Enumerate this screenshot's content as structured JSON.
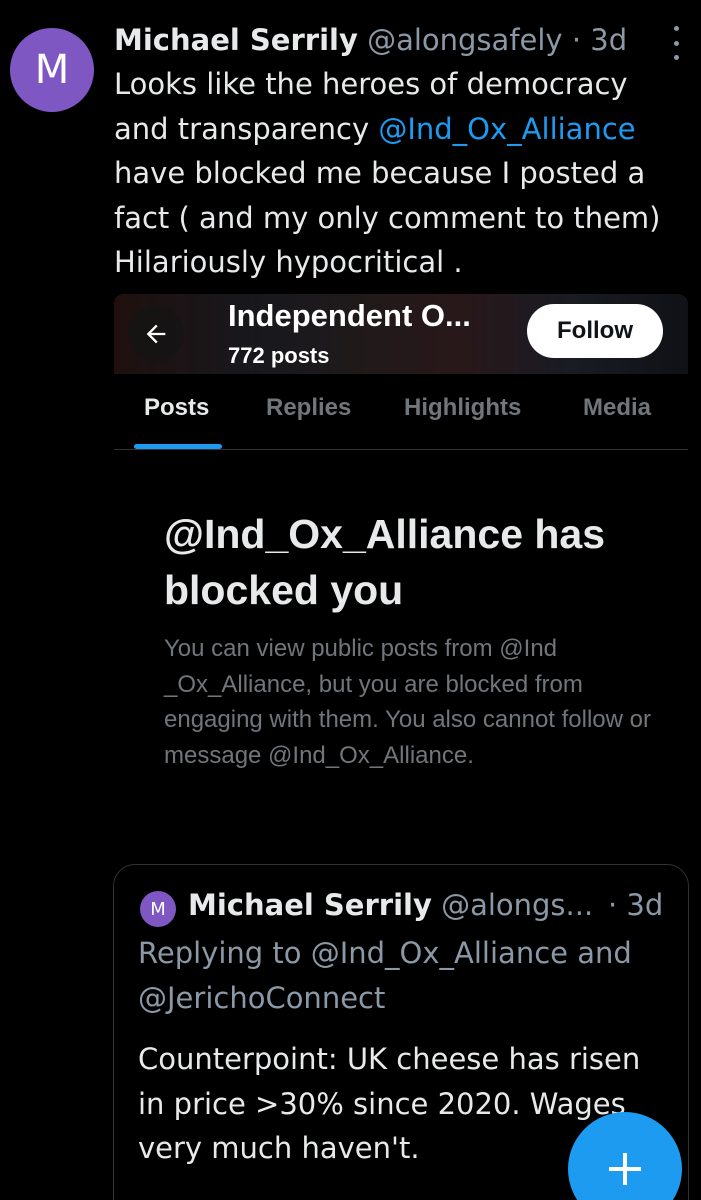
{
  "tweet": {
    "avatar_letter": "M",
    "author_name": "Michael Serrily",
    "handle": "@alongsafely",
    "separator": "·",
    "time": "3d",
    "text_lines": {
      "l1": "Looks like the heroes of democracy",
      "l2_pre": "and transparency ",
      "l2_mention": "@Ind_Ox_Alliance",
      "l3": "have blocked me because I posted a",
      "l4": "fact ( and my only comment to them)",
      "l5": "Hilariously hypocritical ."
    }
  },
  "embed": {
    "profile_name": "Independent O...",
    "posts_count": "772 posts",
    "follow_label": "Follow",
    "tabs": [
      {
        "label": "Posts",
        "active": true
      },
      {
        "label": "Replies",
        "active": false
      },
      {
        "label": "Highlights",
        "active": false
      },
      {
        "label": "Media",
        "active": false
      }
    ],
    "blocked_title": "@Ind_Ox_Alliance has blocked you",
    "blocked_desc": "You can view public posts from @Ind _Ox_Alliance, but you are blocked from engaging with them. You also cannot follow or message @Ind_Ox_Alliance."
  },
  "quote": {
    "avatar_letter": "M",
    "author_name": "Michael Serrily",
    "handle": "@alongs...",
    "time": "· 3d",
    "replying": "Replying to @Ind_Ox_Alliance and @JerichoConnect",
    "text": "Counterpoint: UK cheese has risen in price >30% since 2020. Wages very much haven't."
  },
  "fab": {
    "icon": "plus-icon"
  },
  "colors": {
    "accent": "#1d9bf0",
    "avatar": "#7e57c2",
    "background": "#000000",
    "muted": "#8b98a5"
  }
}
